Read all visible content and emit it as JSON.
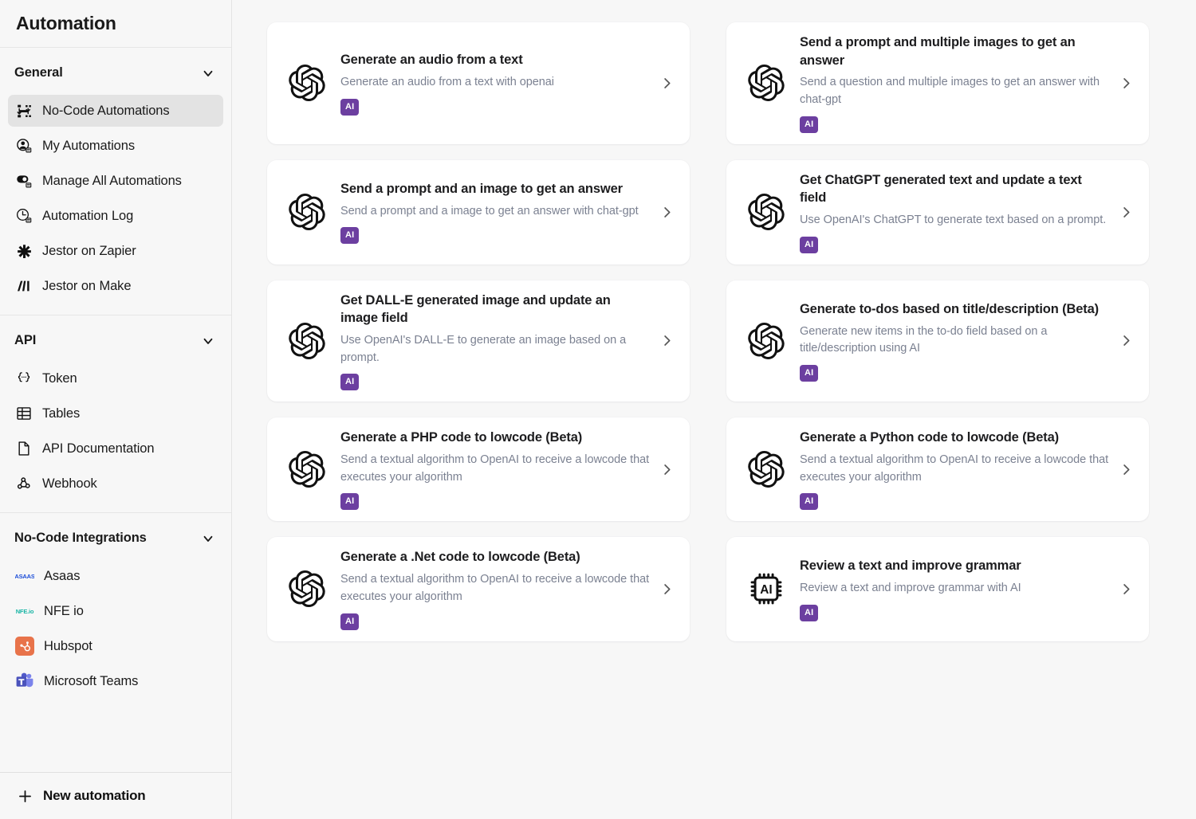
{
  "sidebar": {
    "title": "Automation",
    "sections": [
      {
        "label": "General",
        "items": [
          {
            "label": "No-Code Automations",
            "icon": "flow-diagram-icon",
            "active": true
          },
          {
            "label": "My Automations",
            "icon": "user-circle-icon",
            "active": false
          },
          {
            "label": "Manage All Automations",
            "icon": "toggle-circle-icon",
            "active": false
          },
          {
            "label": "Automation Log",
            "icon": "clock-icon",
            "active": false
          },
          {
            "label": "Jestor on Zapier",
            "icon": "zapier-asterisk-icon",
            "active": false
          },
          {
            "label": "Jestor on Make",
            "icon": "make-logo-icon",
            "active": false
          }
        ]
      },
      {
        "label": "API",
        "items": [
          {
            "label": "Token",
            "icon": "curly-braces-icon",
            "active": false
          },
          {
            "label": "Tables",
            "icon": "table-grid-icon",
            "active": false
          },
          {
            "label": "API Documentation",
            "icon": "document-page-icon",
            "active": false
          },
          {
            "label": "Webhook",
            "icon": "webhook-icon",
            "active": false
          }
        ]
      },
      {
        "label": "No-Code Integrations",
        "items": [
          {
            "label": "Asaas",
            "icon": "asaas-logo-icon",
            "active": false
          },
          {
            "label": "NFE io",
            "icon": "nfeio-logo-icon",
            "active": false
          },
          {
            "label": "Hubspot",
            "icon": "hubspot-logo-icon",
            "active": false
          },
          {
            "label": "Microsoft Teams",
            "icon": "microsoft-teams-logo-icon",
            "active": false
          }
        ]
      }
    ],
    "footer": {
      "label": "New automation",
      "icon": "plus-icon"
    }
  },
  "colors": {
    "badge_background": "#6c3fa0",
    "badge_text": "#ffffff",
    "sidebar_background": "#f7f7f7",
    "card_background": "#ffffff",
    "active_item_background": "#e3e3e3",
    "description_text": "#7b8191"
  },
  "main": {
    "cards": [
      {
        "title": "Generate an audio from a text",
        "description": "Generate an audio from a text with openai",
        "badge": "AI",
        "icon": "openai-logo-icon"
      },
      {
        "title": "Send a prompt and multiple images to get an answer",
        "description": "Send a question and multiple images to get an answer with chat-gpt",
        "badge": "AI",
        "icon": "openai-logo-icon"
      },
      {
        "title": "Send a prompt and an image to get an answer",
        "description": "Send a prompt and a image to get an answer with chat-gpt",
        "badge": "AI",
        "icon": "openai-logo-icon"
      },
      {
        "title": "Get ChatGPT generated text and update a text field",
        "description": "Use OpenAI's ChatGPT to generate text based on a prompt.",
        "badge": "AI",
        "icon": "openai-logo-icon"
      },
      {
        "title": "Get DALL-E generated image and update an image field",
        "description": "Use OpenAI's DALL-E to generate an image based on a prompt.",
        "badge": "AI",
        "icon": "openai-logo-icon"
      },
      {
        "title": "Generate to-dos based on title/description (Beta)",
        "description": "Generate new items in the to-do field based on a title/description using AI",
        "badge": "AI",
        "icon": "openai-logo-icon"
      },
      {
        "title": "Generate a PHP code to lowcode (Beta)",
        "description": "Send a textual algorithm to OpenAI to receive a lowcode that executes your algorithm",
        "badge": "AI",
        "icon": "openai-logo-icon"
      },
      {
        "title": "Generate a Python code to lowcode (Beta)",
        "description": "Send a textual algorithm to OpenAI to receive a lowcode that executes your algorithm",
        "badge": "AI",
        "icon": "openai-logo-icon"
      },
      {
        "title": "Generate a .Net code to lowcode (Beta)",
        "description": "Send a textual algorithm to OpenAI to receive a lowcode that executes your algorithm",
        "badge": "AI",
        "icon": "openai-logo-icon"
      },
      {
        "title": "Review a text and improve grammar",
        "description": "Review a text and improve grammar with AI",
        "badge": "AI",
        "icon": "ai-chip-icon"
      }
    ]
  }
}
